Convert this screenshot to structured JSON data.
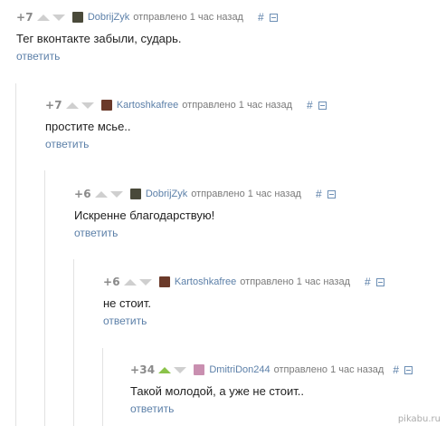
{
  "sent_label": "отправлено 1 час назад",
  "reply_label": "ответить",
  "hash_label": "#",
  "comments": [
    {
      "rating": "+7",
      "author": "DobrijZyk",
      "text": "Тег вконтакте забыли, сударь.",
      "upvoted": false,
      "avatar_color": "#4a4a3a"
    },
    {
      "rating": "+7",
      "author": "Kartoshkafree",
      "text": "простите мсье..",
      "upvoted": false,
      "avatar_color": "#6b3a2a"
    },
    {
      "rating": "+6",
      "author": "DobrijZyk",
      "text": "Искренне благодарствую!",
      "upvoted": false,
      "avatar_color": "#4a4a3a"
    },
    {
      "rating": "+6",
      "author": "Kartoshkafree",
      "text": "не стоит.",
      "upvoted": false,
      "avatar_color": "#6b3a2a"
    },
    {
      "rating": "+34",
      "author": "DmitriDon244",
      "text": "Такой молодой, а уже не стоит..",
      "upvoted": true,
      "avatar_color": "#c98fb0"
    }
  ],
  "watermark": "pikabu.ru"
}
